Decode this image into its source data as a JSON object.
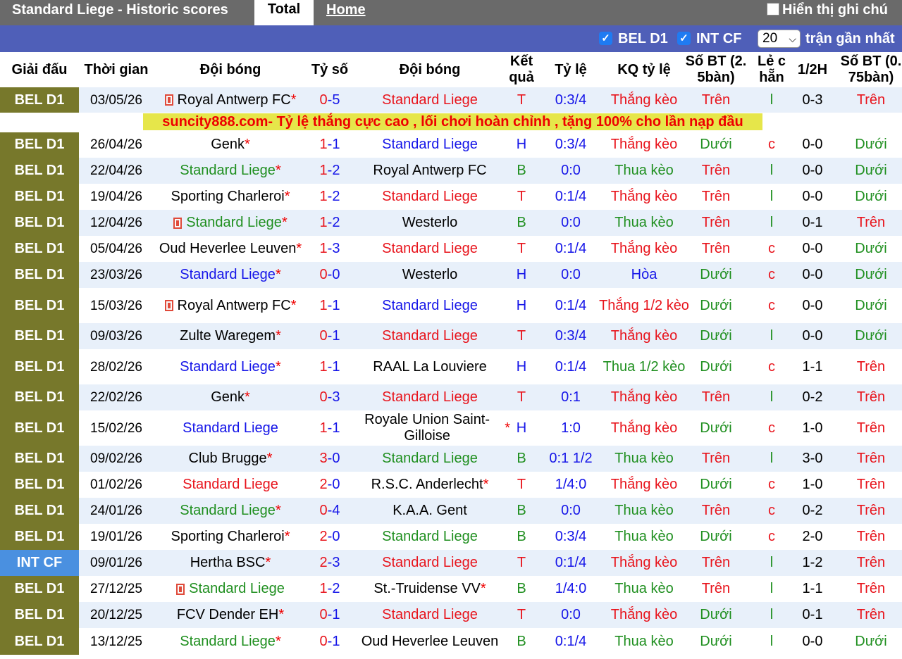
{
  "header": {
    "title": "Standard Liege - Historic scores",
    "tab_total": "Total",
    "tab_home": "Home",
    "notes_label": "Hiển thị ghi chú"
  },
  "filters": {
    "league1": "BEL D1",
    "league2": "INT CF",
    "count": "20",
    "count_label": "trận gần nhất"
  },
  "columns": [
    "Giải đấu",
    "Thời gian",
    "Đội bóng",
    "Tỷ số",
    "Đội bóng",
    "Kết quả",
    "Tỷ lệ",
    "KQ tỷ lệ",
    "Số BT (2. 5bàn)",
    "Lẻ c hẵn",
    "1/2H",
    "Số BT (0. 75bàn)"
  ],
  "ad_text": "suncity888.com- Tỷ lệ thắng cực cao , lối chơi hoàn chỉnh , tặng 100% cho lần nạp đầu",
  "colors": {
    "red": "#e8141c",
    "blue": "#1515e8",
    "green": "#1f8f1f",
    "black": "#000000",
    "league_bel": "#77782b",
    "league_int": "#4a90e0"
  },
  "matches": [
    {
      "league": "BEL D1",
      "date": "03/05/26",
      "home": "Royal Antwerp FC",
      "home_star": "*",
      "home_flag": true,
      "home_color": "black",
      "score1": "0",
      "score2": "5",
      "score_color": "blue",
      "away": "Standard Liege",
      "away_star": "",
      "away_color": "red",
      "result": "T",
      "result_color": "red",
      "odds": "0:3/4",
      "odds_result": "Thắng kèo",
      "or_color": "red",
      "bt25": "Trên",
      "bt25_color": "red",
      "oe": "l",
      "oe_color": "green",
      "half": "0-3",
      "bt075": "Trên",
      "bt075_color": "red"
    },
    {
      "league": "BEL D1",
      "date": "26/04/26",
      "home": "Genk",
      "home_star": "*",
      "home_flag": false,
      "home_color": "black",
      "score1": "1",
      "score2": "1",
      "score_color": "blue",
      "away": "Standard Liege",
      "away_star": "",
      "away_color": "blue",
      "result": "H",
      "result_color": "blue",
      "odds": "0:3/4",
      "odds_result": "Thắng kèo",
      "or_color": "red",
      "bt25": "Dưới",
      "bt25_color": "green",
      "oe": "c",
      "oe_color": "red",
      "half": "0-0",
      "bt075": "Dưới",
      "bt075_color": "green"
    },
    {
      "league": "BEL D1",
      "date": "22/04/26",
      "home": "Standard Liege",
      "home_star": "*",
      "home_flag": false,
      "home_color": "green",
      "score1": "1",
      "score2": "2",
      "score_color": "blue",
      "away": "Royal Antwerp FC",
      "away_star": "",
      "away_color": "black",
      "result": "B",
      "result_color": "green",
      "odds": "0:0",
      "odds_result": "Thua kèo",
      "or_color": "green",
      "bt25": "Trên",
      "bt25_color": "red",
      "oe": "l",
      "oe_color": "green",
      "half": "0-0",
      "bt075": "Dưới",
      "bt075_color": "green"
    },
    {
      "league": "BEL D1",
      "date": "19/04/26",
      "home": "Sporting Charleroi",
      "home_star": "*",
      "home_flag": false,
      "home_color": "black",
      "score1": "1",
      "score2": "2",
      "score_color": "blue",
      "away": "Standard Liege",
      "away_star": "",
      "away_color": "red",
      "result": "T",
      "result_color": "red",
      "odds": "0:1/4",
      "odds_result": "Thắng kèo",
      "or_color": "red",
      "bt25": "Trên",
      "bt25_color": "red",
      "oe": "l",
      "oe_color": "green",
      "half": "0-0",
      "bt075": "Dưới",
      "bt075_color": "green"
    },
    {
      "league": "BEL D1",
      "date": "12/04/26",
      "home": "Standard Liege",
      "home_star": "*",
      "home_flag": true,
      "home_color": "green",
      "score1": "1",
      "score2": "2",
      "score_color": "blue",
      "away": "Westerlo",
      "away_star": "",
      "away_color": "black",
      "result": "B",
      "result_color": "green",
      "odds": "0:0",
      "odds_result": "Thua kèo",
      "or_color": "green",
      "bt25": "Trên",
      "bt25_color": "red",
      "oe": "l",
      "oe_color": "green",
      "half": "0-1",
      "bt075": "Trên",
      "bt075_color": "red"
    },
    {
      "league": "BEL D1",
      "date": "05/04/26",
      "home": "Oud Heverlee Leuven",
      "home_star": "*",
      "home_flag": false,
      "home_color": "black",
      "score1": "1",
      "score2": "3",
      "score_color": "blue",
      "away": "Standard Liege",
      "away_star": "",
      "away_color": "red",
      "result": "T",
      "result_color": "red",
      "odds": "0:1/4",
      "odds_result": "Thắng kèo",
      "or_color": "red",
      "bt25": "Trên",
      "bt25_color": "red",
      "oe": "c",
      "oe_color": "red",
      "half": "0-0",
      "bt075": "Dưới",
      "bt075_color": "green"
    },
    {
      "league": "BEL D1",
      "date": "23/03/26",
      "home": "Standard Liege",
      "home_star": "*",
      "home_flag": false,
      "home_color": "blue",
      "score1": "0",
      "score2": "0",
      "score_color": "blue",
      "away": "Westerlo",
      "away_star": "",
      "away_color": "black",
      "result": "H",
      "result_color": "blue",
      "odds": "0:0",
      "odds_result": "Hòa",
      "or_color": "blue",
      "bt25": "Dưới",
      "bt25_color": "green",
      "oe": "c",
      "oe_color": "red",
      "half": "0-0",
      "bt075": "Dưới",
      "bt075_color": "green"
    },
    {
      "league": "BEL D1",
      "date": "15/03/26",
      "home": "Royal Antwerp FC",
      "home_star": "*",
      "home_flag": true,
      "home_color": "black",
      "score1": "1",
      "score2": "1",
      "score_color": "blue",
      "away": "Standard Liege",
      "away_star": "",
      "away_color": "blue",
      "result": "H",
      "result_color": "blue",
      "odds": "0:1/4",
      "odds_result": "Thắng 1/2 kèo",
      "or_color": "red",
      "bt25": "Dưới",
      "bt25_color": "green",
      "oe": "c",
      "oe_color": "red",
      "half": "0-0",
      "bt075": "Dưới",
      "bt075_color": "green"
    },
    {
      "league": "BEL D1",
      "date": "09/03/26",
      "home": "Zulte Waregem",
      "home_star": "*",
      "home_flag": false,
      "home_color": "black",
      "score1": "0",
      "score2": "1",
      "score_color": "blue",
      "away": "Standard Liege",
      "away_star": "",
      "away_color": "red",
      "result": "T",
      "result_color": "red",
      "odds": "0:3/4",
      "odds_result": "Thắng kèo",
      "or_color": "red",
      "bt25": "Dưới",
      "bt25_color": "green",
      "oe": "l",
      "oe_color": "green",
      "half": "0-0",
      "bt075": "Dưới",
      "bt075_color": "green"
    },
    {
      "league": "BEL D1",
      "date": "28/02/26",
      "home": "Standard Liege",
      "home_star": "*",
      "home_flag": false,
      "home_color": "blue",
      "score1": "1",
      "score2": "1",
      "score_color": "blue",
      "away": "RAAL La Louviere",
      "away_star": "",
      "away_color": "black",
      "result": "H",
      "result_color": "blue",
      "odds": "0:1/4",
      "odds_result": "Thua 1/2 kèo",
      "or_color": "green",
      "bt25": "Dưới",
      "bt25_color": "green",
      "oe": "c",
      "oe_color": "red",
      "half": "1-1",
      "bt075": "Trên",
      "bt075_color": "red"
    },
    {
      "league": "BEL D1",
      "date": "22/02/26",
      "home": "Genk",
      "home_star": "*",
      "home_flag": false,
      "home_color": "black",
      "score1": "0",
      "score2": "3",
      "score_color": "blue",
      "away": "Standard Liege",
      "away_star": "",
      "away_color": "red",
      "result": "T",
      "result_color": "red",
      "odds": "0:1",
      "odds_result": "Thắng kèo",
      "or_color": "red",
      "bt25": "Trên",
      "bt25_color": "red",
      "oe": "l",
      "oe_color": "green",
      "half": "0-2",
      "bt075": "Trên",
      "bt075_color": "red"
    },
    {
      "league": "BEL D1",
      "date": "15/02/26",
      "home": "Standard Liege",
      "home_star": "",
      "home_flag": false,
      "home_color": "blue",
      "score1": "1",
      "score2": "1",
      "score_color": "blue",
      "away": "Royale Union Saint-Gilloise",
      "away_star": "*",
      "away_color": "black",
      "result": "H",
      "result_color": "blue",
      "odds": "1:0",
      "odds_result": "Thắng kèo",
      "or_color": "red",
      "bt25": "Dưới",
      "bt25_color": "green",
      "oe": "c",
      "oe_color": "red",
      "half": "1-0",
      "bt075": "Trên",
      "bt075_color": "red"
    },
    {
      "league": "BEL D1",
      "date": "09/02/26",
      "home": "Club Brugge",
      "home_star": "*",
      "home_flag": false,
      "home_color": "black",
      "score1": "3",
      "score2": "0",
      "score_color": "blue",
      "away": "Standard Liege",
      "away_star": "",
      "away_color": "green",
      "result": "B",
      "result_color": "green",
      "odds": "0:1 1/2",
      "odds_result": "Thua kèo",
      "or_color": "green",
      "bt25": "Trên",
      "bt25_color": "red",
      "oe": "l",
      "oe_color": "green",
      "half": "3-0",
      "bt075": "Trên",
      "bt075_color": "red"
    },
    {
      "league": "BEL D1",
      "date": "01/02/26",
      "home": "Standard Liege",
      "home_star": "",
      "home_flag": false,
      "home_color": "red",
      "score1": "2",
      "score2": "0",
      "score_color": "blue",
      "away": "R.S.C. Anderlecht",
      "away_star": "*",
      "away_color": "black",
      "result": "T",
      "result_color": "red",
      "odds": "1/4:0",
      "odds_result": "Thắng kèo",
      "or_color": "red",
      "bt25": "Dưới",
      "bt25_color": "green",
      "oe": "c",
      "oe_color": "red",
      "half": "1-0",
      "bt075": "Trên",
      "bt075_color": "red"
    },
    {
      "league": "BEL D1",
      "date": "24/01/26",
      "home": "Standard Liege",
      "home_star": "*",
      "home_flag": false,
      "home_color": "green",
      "score1": "0",
      "score2": "4",
      "score_color": "blue",
      "away": "K.A.A. Gent",
      "away_star": "",
      "away_color": "black",
      "result": "B",
      "result_color": "green",
      "odds": "0:0",
      "odds_result": "Thua kèo",
      "or_color": "green",
      "bt25": "Trên",
      "bt25_color": "red",
      "oe": "c",
      "oe_color": "red",
      "half": "0-2",
      "bt075": "Trên",
      "bt075_color": "red"
    },
    {
      "league": "BEL D1",
      "date": "19/01/26",
      "home": "Sporting Charleroi",
      "home_star": "*",
      "home_flag": false,
      "home_color": "black",
      "score1": "2",
      "score2": "0",
      "score_color": "blue",
      "away": "Standard Liege",
      "away_star": "",
      "away_color": "green",
      "result": "B",
      "result_color": "green",
      "odds": "0:3/4",
      "odds_result": "Thua kèo",
      "or_color": "green",
      "bt25": "Dưới",
      "bt25_color": "green",
      "oe": "c",
      "oe_color": "red",
      "half": "2-0",
      "bt075": "Trên",
      "bt075_color": "red"
    },
    {
      "league": "INT CF",
      "date": "09/01/26",
      "home": "Hertha BSC",
      "home_star": "*",
      "home_flag": false,
      "home_color": "black",
      "score1": "2",
      "score2": "3",
      "score_color": "blue",
      "away": "Standard Liege",
      "away_star": "",
      "away_color": "red",
      "result": "T",
      "result_color": "red",
      "odds": "0:1/4",
      "odds_result": "Thắng kèo",
      "or_color": "red",
      "bt25": "Trên",
      "bt25_color": "red",
      "oe": "l",
      "oe_color": "green",
      "half": "1-2",
      "bt075": "Trên",
      "bt075_color": "red"
    },
    {
      "league": "BEL D1",
      "date": "27/12/25",
      "home": "Standard Liege",
      "home_star": "",
      "home_flag": true,
      "home_color": "green",
      "score1": "1",
      "score2": "2",
      "score_color": "blue",
      "away": "St.-Truidense VV",
      "away_star": "*",
      "away_color": "black",
      "result": "B",
      "result_color": "green",
      "odds": "1/4:0",
      "odds_result": "Thua kèo",
      "or_color": "green",
      "bt25": "Trên",
      "bt25_color": "red",
      "oe": "l",
      "oe_color": "green",
      "half": "1-1",
      "bt075": "Trên",
      "bt075_color": "red"
    },
    {
      "league": "BEL D1",
      "date": "20/12/25",
      "home": "FCV Dender EH",
      "home_star": "*",
      "home_flag": false,
      "home_color": "black",
      "score1": "0",
      "score2": "1",
      "score_color": "blue",
      "away": "Standard Liege",
      "away_star": "",
      "away_color": "red",
      "result": "T",
      "result_color": "red",
      "odds": "0:0",
      "odds_result": "Thắng kèo",
      "or_color": "red",
      "bt25": "Dưới",
      "bt25_color": "green",
      "oe": "l",
      "oe_color": "green",
      "half": "0-1",
      "bt075": "Trên",
      "bt075_color": "red"
    },
    {
      "league": "BEL D1",
      "date": "13/12/25",
      "home": "Standard Liege",
      "home_star": "*",
      "home_flag": false,
      "home_color": "green",
      "score1": "0",
      "score2": "1",
      "score_color": "blue",
      "away": "Oud Heverlee Leuven",
      "away_star": "",
      "away_color": "black",
      "result": "B",
      "result_color": "green",
      "odds": "0:1/4",
      "odds_result": "Thua kèo",
      "or_color": "green",
      "bt25": "Dưới",
      "bt25_color": "green",
      "oe": "l",
      "oe_color": "green",
      "half": "0-0",
      "bt075": "Dưới",
      "bt075_color": "green"
    }
  ]
}
